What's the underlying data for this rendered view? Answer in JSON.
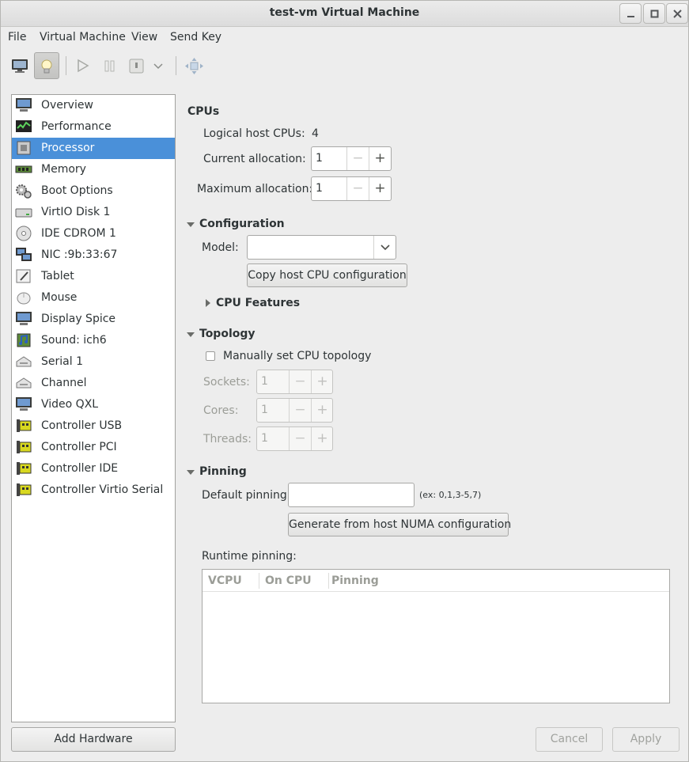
{
  "window": {
    "title": "test-vm Virtual Machine"
  },
  "menubar": {
    "items": [
      "File",
      "Virtual Machine",
      "View",
      "Send Key"
    ]
  },
  "toolbar": {
    "buttons": [
      "console-button",
      "details-button",
      "run-button",
      "pause-button",
      "shutdown-button",
      "shutdown-menu-button",
      "fullscreen-button"
    ],
    "active": "details-button"
  },
  "sidebar": {
    "selected": "Processor",
    "items": [
      {
        "label": "Overview",
        "icon": "monitor-icon"
      },
      {
        "label": "Performance",
        "icon": "performance-graph-icon"
      },
      {
        "label": "Processor",
        "icon": "cpu-chip-icon"
      },
      {
        "label": "Memory",
        "icon": "memory-module-icon"
      },
      {
        "label": "Boot Options",
        "icon": "gears-icon"
      },
      {
        "label": "VirtIO Disk 1",
        "icon": "hard-disk-icon"
      },
      {
        "label": "IDE CDROM 1",
        "icon": "cdrom-icon"
      },
      {
        "label": "NIC :9b:33:67",
        "icon": "network-card-icon"
      },
      {
        "label": "Tablet",
        "icon": "tablet-icon"
      },
      {
        "label": "Mouse",
        "icon": "mouse-icon"
      },
      {
        "label": "Display Spice",
        "icon": "display-icon"
      },
      {
        "label": "Sound: ich6",
        "icon": "sound-card-icon"
      },
      {
        "label": "Serial 1",
        "icon": "serial-port-icon"
      },
      {
        "label": "Channel",
        "icon": "channel-icon"
      },
      {
        "label": "Video QXL",
        "icon": "video-card-icon"
      },
      {
        "label": "Controller USB",
        "icon": "controller-card-icon"
      },
      {
        "label": "Controller PCI",
        "icon": "controller-card-icon"
      },
      {
        "label": "Controller IDE",
        "icon": "controller-card-icon"
      },
      {
        "label": "Controller Virtio Serial",
        "icon": "controller-card-icon"
      }
    ],
    "add_hardware_label": "Add Hardware"
  },
  "cpus": {
    "title": "CPUs",
    "logical_label": "Logical host CPUs:",
    "logical_value": "4",
    "current_label": "Current allocation:",
    "current_value": "1",
    "max_label": "Maximum allocation:",
    "max_value": "1"
  },
  "configuration": {
    "title": "Configuration",
    "model_label": "Model:",
    "model_value": "",
    "copy_button": "Copy host CPU configuration",
    "features_title": "CPU Features"
  },
  "topology": {
    "title": "Topology",
    "manual_label": "Manually set CPU topology",
    "manual_checked": false,
    "sockets_label": "Sockets:",
    "sockets_value": "1",
    "cores_label": "Cores:",
    "cores_value": "1",
    "threads_label": "Threads:",
    "threads_value": "1"
  },
  "pinning": {
    "title": "Pinning",
    "default_label": "Default pinning:",
    "default_value": "",
    "example": "(ex: 0,1,3-5,7)",
    "numa_button": "Generate from host NUMA configuration",
    "runtime_label": "Runtime pinning:",
    "columns": [
      "VCPU",
      "On CPU",
      "Pinning"
    ],
    "rows": []
  },
  "footer": {
    "cancel": "Cancel",
    "apply": "Apply"
  }
}
